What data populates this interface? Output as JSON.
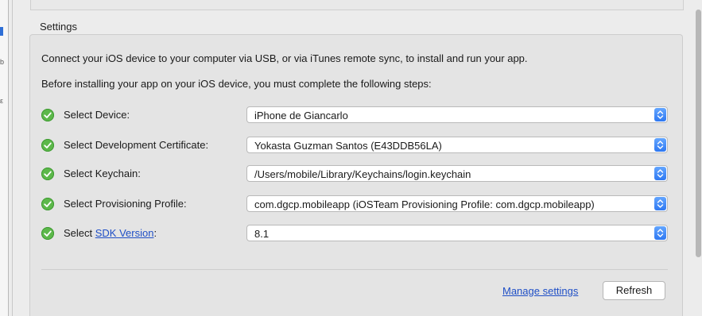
{
  "settings": {
    "title": "Settings",
    "intro_line_1": "Connect your iOS device to your computer via USB, or via iTunes remote sync, to install and run your app.",
    "intro_line_2": "Before installing your app on your iOS device, you must complete the following steps:"
  },
  "steps": [
    {
      "label": "Select Device:",
      "value": "iPhone de Giancarlo",
      "status": "check-icon"
    },
    {
      "label": "Select Development Certificate:",
      "value": "Yokasta Guzman Santos (E43DDB56LA)",
      "status": "check-icon"
    },
    {
      "label": "Select Keychain:",
      "value": "/Users/mobile/Library/Keychains/login.keychain",
      "status": "check-icon"
    },
    {
      "label": "Select Provisioning Profile:",
      "value": "com.dgcp.mobileapp (iOSTeam Provisioning Profile: com.dgcp.mobileapp)",
      "status": "check-icon"
    },
    {
      "label_prefix": "Select ",
      "label_link": "SDK Version",
      "label_suffix": ":",
      "value": "8.1",
      "status": "check-icon"
    }
  ],
  "footer": {
    "manage_link": "Manage settings",
    "refresh_label": "Refresh"
  },
  "colors": {
    "accent": "#2e78f2",
    "link": "#1f4fc6",
    "check": "#5cb84a"
  }
}
